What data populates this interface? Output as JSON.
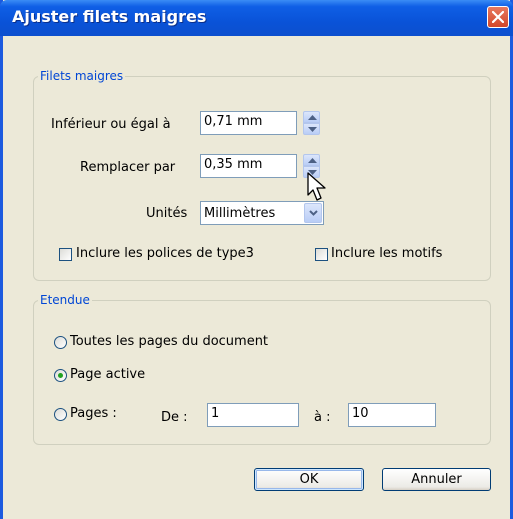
{
  "window": {
    "title": "Ajuster filets maigres"
  },
  "group_filets": {
    "legend": "Filets maigres",
    "lower_label": "Inférieur ou égal à",
    "lower_value": "0,71 mm",
    "replace_label": "Remplacer par",
    "replace_value": "0,35 mm",
    "units_label": "Unités",
    "units_value": "Millimètres",
    "include_type3_label": "Inclure les polices de type3",
    "include_patterns_label": "Inclure les motifs"
  },
  "group_range": {
    "legend": "Etendue",
    "all_pages_label": "Toutes les pages du document",
    "active_page_label": "Page active",
    "pages_label": "Pages :",
    "from_label": "De :",
    "from_value": "1",
    "to_label": "à :",
    "to_value": "10",
    "selected": "Page active"
  },
  "buttons": {
    "ok": "OK",
    "cancel": "Annuler"
  },
  "colors": {
    "title_bar": "#0a53d8",
    "legend_text": "#0046d5",
    "radio_selected": "#21a121",
    "close_button": "#d2462a"
  },
  "icons": {
    "close": "close-icon",
    "spin_up": "arrow-up-icon",
    "spin_down": "arrow-down-icon",
    "dropdown": "chevron-down-icon",
    "cursor": "mouse-pointer-icon"
  }
}
